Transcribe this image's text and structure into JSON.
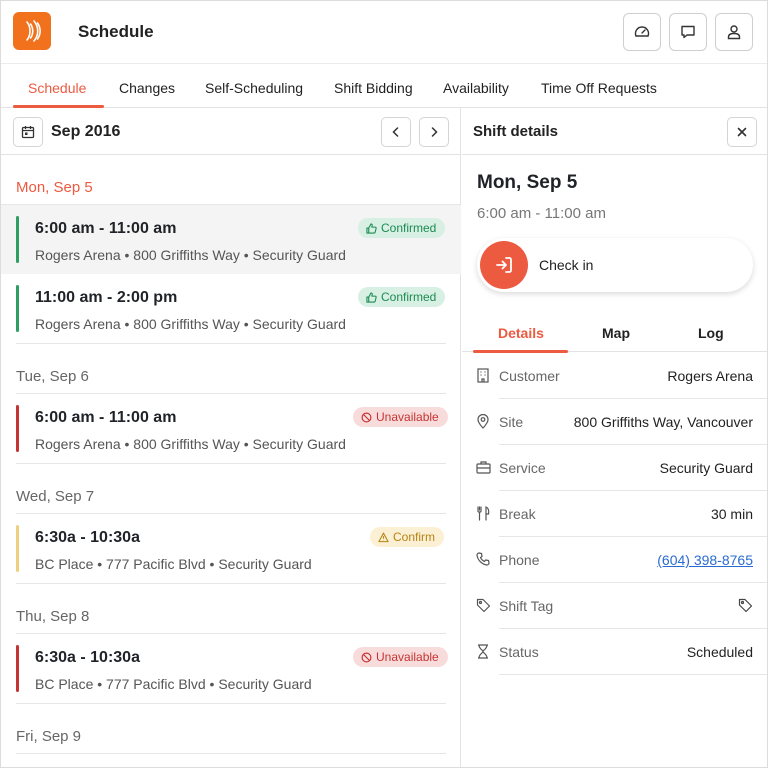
{
  "header": {
    "title": "Schedule",
    "logo_icon": "radio-waves-logo",
    "buttons": [
      {
        "name": "dashboard",
        "icon": "gauge-icon"
      },
      {
        "name": "messages",
        "icon": "chat-icon"
      },
      {
        "name": "profile",
        "icon": "user-icon"
      }
    ]
  },
  "tabs": [
    {
      "label": "Schedule",
      "active": true
    },
    {
      "label": "Changes"
    },
    {
      "label": "Self-Scheduling"
    },
    {
      "label": "Shift Bidding"
    },
    {
      "label": "Availability"
    },
    {
      "label": "Time Off Requests"
    }
  ],
  "calendar": {
    "month": "Sep 2016"
  },
  "days": [
    {
      "label": "Mon, Sep 5",
      "today": true,
      "shifts": [
        {
          "time": "6:00 am - 11:00 am",
          "location": "Rogers Arena • 800 Griffiths Way • Security Guard",
          "status": "Confirmed",
          "status_type": "green",
          "selected": true
        },
        {
          "time": "11:00 am - 2:00 pm",
          "location": "Rogers Arena • 800 Griffiths Way • Security Guard",
          "status": "Confirmed",
          "status_type": "green"
        }
      ]
    },
    {
      "label": "Tue, Sep 6",
      "shifts": [
        {
          "time": "6:00 am - 11:00 am",
          "location": "Rogers Arena • 800 Griffiths Way • Security Guard",
          "status": "Unavailable",
          "status_type": "red"
        }
      ]
    },
    {
      "label": "Wed, Sep 7",
      "shifts": [
        {
          "time": "6:30a - 10:30a",
          "location": "BC Place • 777 Pacific Blvd • Security Guard",
          "status": "Confirm",
          "status_type": "yellow"
        }
      ]
    },
    {
      "label": "Thu, Sep 8",
      "shifts": [
        {
          "time": "6:30a - 10:30a",
          "location": "BC Place • 777 Pacific Blvd • Security Guard",
          "status": "Unavailable",
          "status_type": "red"
        }
      ]
    },
    {
      "label": "Fri, Sep 9",
      "shifts": []
    }
  ],
  "colors": {
    "accent": "#ec5a40",
    "confirmed": "#1e8a52",
    "unavailable": "#c53434",
    "pending": "#e8b93c"
  },
  "details": {
    "title": "Shift details",
    "date": "Mon, Sep 5",
    "time": "6:00 am - 11:00 am",
    "checkin_label": "Check in",
    "tabs": [
      {
        "label": "Details",
        "active": true
      },
      {
        "label": "Map"
      },
      {
        "label": "Log"
      }
    ],
    "rows": [
      {
        "key": "Customer",
        "value": "Rogers Arena",
        "icon": "building-icon"
      },
      {
        "key": "Site",
        "value": "800 Griffiths Way, Vancouver",
        "icon": "map-pin-icon"
      },
      {
        "key": "Service",
        "value": "Security Guard",
        "icon": "briefcase-icon"
      },
      {
        "key": "Break",
        "value": "30 min",
        "icon": "utensils-icon"
      },
      {
        "key": "Phone",
        "value": "(604) 398-8765",
        "icon": "phone-icon",
        "link": true
      },
      {
        "key": "Shift Tag",
        "value": "",
        "icon": "tag-icon"
      },
      {
        "key": "Status",
        "value": "Scheduled",
        "icon": "hourglass-icon"
      }
    ]
  }
}
